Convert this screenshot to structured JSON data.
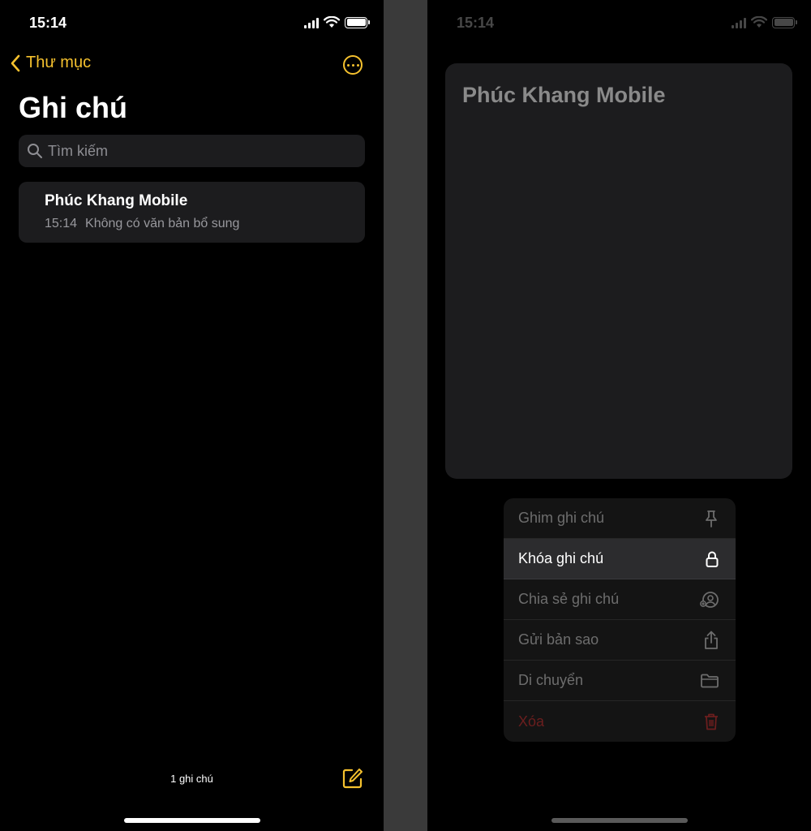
{
  "left": {
    "status": {
      "time": "15:14"
    },
    "nav": {
      "back_label": "Thư mục"
    },
    "title": "Ghi chú",
    "search": {
      "placeholder": "Tìm kiếm"
    },
    "note": {
      "title": "Phúc Khang Mobile",
      "time": "15:14",
      "preview": "Không có văn bản bổ sung"
    },
    "footer": {
      "count": "1 ghi chú"
    }
  },
  "right": {
    "status": {
      "time": "15:14"
    },
    "preview_title": "Phúc Khang Mobile",
    "menu": [
      {
        "label": "Ghim ghi chú",
        "icon": "pin-icon"
      },
      {
        "label": "Khóa ghi chú",
        "icon": "lock-icon"
      },
      {
        "label": "Chia sẻ ghi chú",
        "icon": "share-person-icon"
      },
      {
        "label": "Gửi bản sao",
        "icon": "share-icon"
      },
      {
        "label": "Di chuyển",
        "icon": "folder-icon"
      },
      {
        "label": "Xóa",
        "icon": "trash-icon"
      }
    ]
  },
  "colors": {
    "accent": "#f5c12e",
    "background": "#000000",
    "card": "#1c1c1e",
    "danger": "#ff3b30"
  }
}
